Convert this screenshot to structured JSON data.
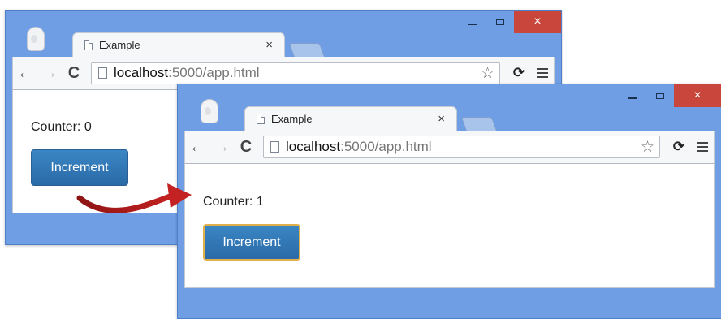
{
  "window_before": {
    "tab_title": "Example",
    "tab_close": "×",
    "url_host": "localhost",
    "url_rest": ":5000/app.html",
    "counter_text": "Counter: 0",
    "button_label": "Increment",
    "controls": {
      "close": "×"
    }
  },
  "window_after": {
    "tab_title": "Example",
    "tab_close": "×",
    "url_host": "localhost",
    "url_rest": ":5000/app.html",
    "counter_text": "Counter: 1",
    "button_label": "Increment",
    "controls": {
      "close": "×"
    }
  },
  "toolbar_glyphs": {
    "back": "←",
    "forward": "→",
    "reload": "C",
    "star": "☆",
    "extension": "⟳"
  },
  "colors": {
    "window_frame": "#6f9ee4",
    "close_button": "#c9463c",
    "increment_button": "#2a6aa7",
    "arrow": "#b51d1d"
  }
}
